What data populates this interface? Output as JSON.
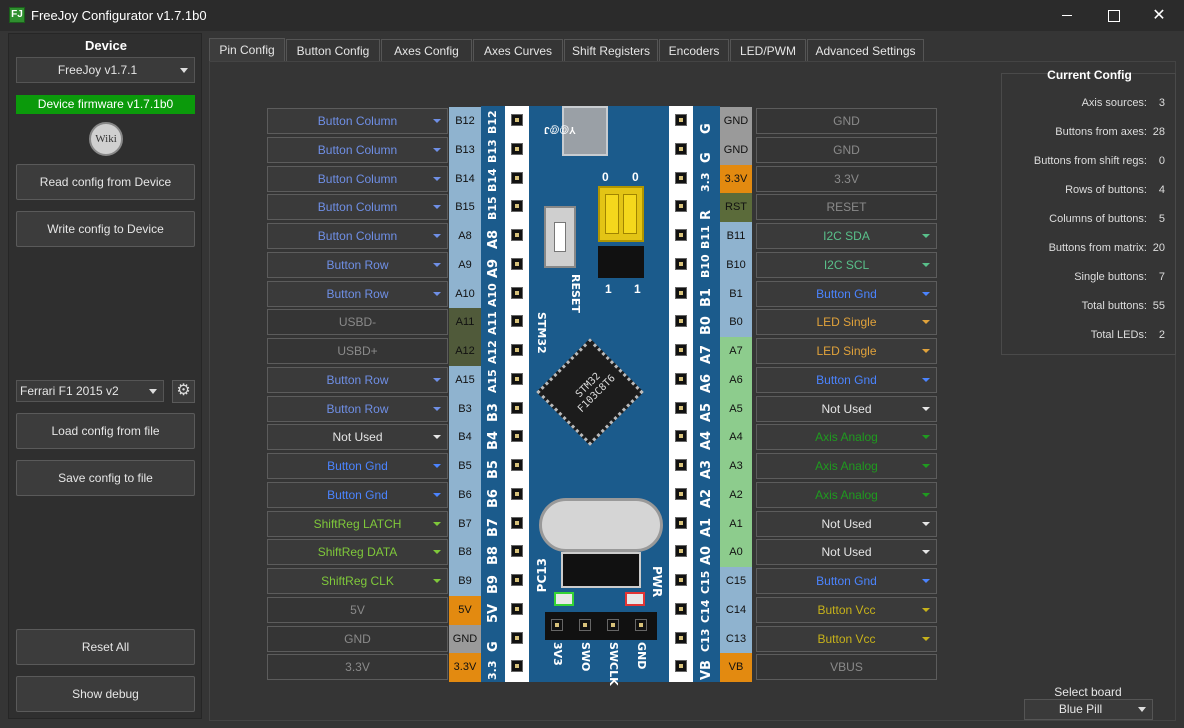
{
  "window": {
    "title": "FreeJoy Configurator v1.7.1b0",
    "icon": "FJ"
  },
  "left": {
    "device_label": "Device",
    "device_value": "FreeJoy v1.7.1",
    "firmware_badge": "Device firmware v1.7.1b0",
    "wiki_label": "Wiki",
    "read_button": "Read config from Device",
    "write_button": "Write config to Device",
    "profile_value": "Ferrari F1 2015 v2",
    "load_button": "Load config from file",
    "save_button": "Save config to file",
    "reset_button": "Reset All",
    "debug_button": "Show debug"
  },
  "tabs": [
    "Pin Config",
    "Button Config",
    "Axes Config",
    "Axes Curves",
    "Shift Registers",
    "Encoders",
    "LED/PWM",
    "Advanced Settings"
  ],
  "left_pins": [
    {
      "label": "B12",
      "func": "Button Column",
      "kind": "btn"
    },
    {
      "label": "B13",
      "func": "Button Column",
      "kind": "btn"
    },
    {
      "label": "B14",
      "func": "Button Column",
      "kind": "btn"
    },
    {
      "label": "B15",
      "func": "Button Column",
      "kind": "btn"
    },
    {
      "label": "A8",
      "func": "Button Column",
      "kind": "btn"
    },
    {
      "label": "A9",
      "func": "Button Row",
      "kind": "btn"
    },
    {
      "label": "A10",
      "func": "Button Row",
      "kind": "btn"
    },
    {
      "label": "A11",
      "func": "USBD-",
      "kind": "disabled"
    },
    {
      "label": "A12",
      "func": "USBD+",
      "kind": "disabled"
    },
    {
      "label": "A15",
      "func": "Button Row",
      "kind": "btn"
    },
    {
      "label": "B3",
      "func": "Button Row",
      "kind": "btn"
    },
    {
      "label": "B4",
      "func": "Not Used",
      "kind": "none"
    },
    {
      "label": "B5",
      "func": "Button Gnd",
      "kind": "gnd"
    },
    {
      "label": "B6",
      "func": "Button Gnd",
      "kind": "gnd"
    },
    {
      "label": "B7",
      "func": "ShiftReg LATCH",
      "kind": "shift"
    },
    {
      "label": "B8",
      "func": "ShiftReg DATA",
      "kind": "shift"
    },
    {
      "label": "B9",
      "func": "ShiftReg CLK",
      "kind": "shift"
    },
    {
      "label": "5V",
      "func": "5V",
      "kind": "disabled"
    },
    {
      "label": "GND",
      "func": "GND",
      "kind": "disabled"
    },
    {
      "label": "3.3V",
      "func": "3.3V",
      "kind": "disabled"
    }
  ],
  "right_pins": [
    {
      "label": "GND",
      "func": "GND",
      "kind": "disabled"
    },
    {
      "label": "GND",
      "func": "GND",
      "kind": "disabled"
    },
    {
      "label": "3.3V",
      "func": "3.3V",
      "kind": "disabled"
    },
    {
      "label": "RST",
      "func": "RESET",
      "kind": "disabled"
    },
    {
      "label": "B11",
      "func": "I2C SDA",
      "kind": "i2c"
    },
    {
      "label": "B10",
      "func": "I2C SCL",
      "kind": "i2c"
    },
    {
      "label": "B1",
      "func": "Button Gnd",
      "kind": "gnd"
    },
    {
      "label": "B0",
      "func": "LED Single",
      "kind": "led"
    },
    {
      "label": "A7",
      "func": "LED Single",
      "kind": "led"
    },
    {
      "label": "A6",
      "func": "Button Gnd",
      "kind": "gnd"
    },
    {
      "label": "A5",
      "func": "Not Used",
      "kind": "none"
    },
    {
      "label": "A4",
      "func": "Axis Analog",
      "kind": "axis"
    },
    {
      "label": "A3",
      "func": "Axis Analog",
      "kind": "axis"
    },
    {
      "label": "A2",
      "func": "Axis Analog",
      "kind": "axis"
    },
    {
      "label": "A1",
      "func": "Not Used",
      "kind": "none"
    },
    {
      "label": "A0",
      "func": "Not Used",
      "kind": "none"
    },
    {
      "label": "C15",
      "func": "Button Gnd",
      "kind": "gnd"
    },
    {
      "label": "C14",
      "func": "Button Vcc",
      "kind": "vcc"
    },
    {
      "label": "C13",
      "func": "Button Vcc",
      "kind": "vcc"
    },
    {
      "label": "VB",
      "func": "VBUS",
      "kind": "disabled"
    }
  ],
  "silk_left": [
    "B12",
    "B13",
    "B14",
    "B15",
    "A8",
    "A9",
    "A10",
    "A11",
    "A12",
    "A15",
    "B3",
    "B4",
    "B5",
    "B6",
    "B7",
    "B8",
    "B9",
    "5V",
    "G",
    "3.3"
  ],
  "silk_right": [
    "G",
    "G",
    "3.3",
    "R",
    "B11",
    "B10",
    "B1",
    "B0",
    "A7",
    "A6",
    "A5",
    "A4",
    "A3",
    "A2",
    "A1",
    "A0",
    "C15",
    "C14",
    "C13",
    "VB"
  ],
  "board_text": {
    "chip": "STM32 F103C8T6",
    "brand": "STM32",
    "reset": "RESET",
    "pc13": "PC13",
    "pwr": "PWR",
    "logo": "Y@@J",
    "jumper_0": "0",
    "jumper_1": "1",
    "swd": [
      "3V3",
      "SWO",
      "SWCLK",
      "GND"
    ]
  },
  "current_config": {
    "title": "Current Config",
    "stats": [
      {
        "label": "Axis sources:",
        "value": "3"
      },
      {
        "label": "Buttons from axes:",
        "value": "28"
      },
      {
        "label": "Buttons from shift regs:",
        "value": "0"
      },
      {
        "label": "Rows of buttons:",
        "value": "4"
      },
      {
        "label": "Columns of buttons:",
        "value": "5"
      },
      {
        "label": "Buttons from matrix:",
        "value": "20"
      },
      {
        "label": "Single buttons:",
        "value": "7"
      },
      {
        "label": "Total buttons:",
        "value": "55"
      },
      {
        "label": "Total LEDs:",
        "value": "2"
      }
    ]
  },
  "board_select": {
    "label": "Select board",
    "value": "Blue Pill"
  },
  "colors": {
    "btn": "#6f8fe6",
    "gnd": "#4b84ff",
    "shift": "#7fc83a",
    "i2c": "#59c08a",
    "led": "#e0a23b",
    "axis": "#1f9b1f",
    "vcc": "#c7b21a",
    "none": "#e6e6e6",
    "disabled": "#8a8a8a"
  }
}
